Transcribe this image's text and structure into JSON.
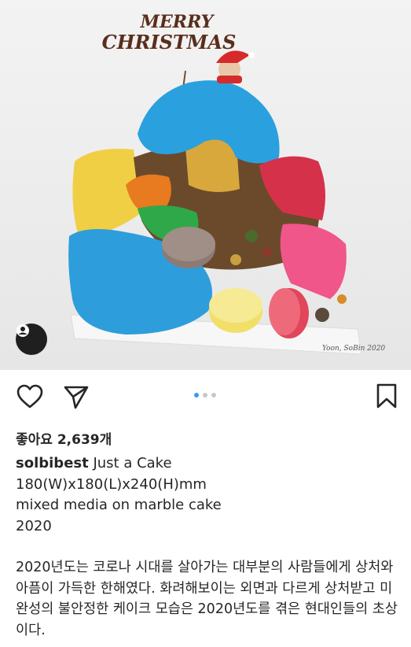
{
  "post": {
    "topper_text": "MERRY CHRISTMAS",
    "artist_signature": "Yoon, SoBin 2020",
    "likes_label": "좋아요 2,639개",
    "username": "solbibest",
    "caption_first": "Just a Cake",
    "caption_lines": [
      "180(W)x180(L)x240(H)mm",
      "mixed media on marble cake",
      "2020"
    ],
    "description": "2020년도는 코로나 시대를 살아가는 대부분의 사람들에게 상처와 아픔이 가득한 한해였다. 화려해보이는 외면과 다르게 상처받고 미완성의 불안정한 케이크 모습은 2020년도를 겪은 현대인들의 초상이다.",
    "carousel": {
      "total": 3,
      "active": 1
    }
  },
  "icons": {
    "like": "heart-icon",
    "share": "send-icon",
    "save": "bookmark-icon",
    "tags": "user-tag-icon"
  },
  "colors": {
    "accent": "#3897f0",
    "text": "#262626",
    "dot_inactive": "#c8c8c8"
  }
}
